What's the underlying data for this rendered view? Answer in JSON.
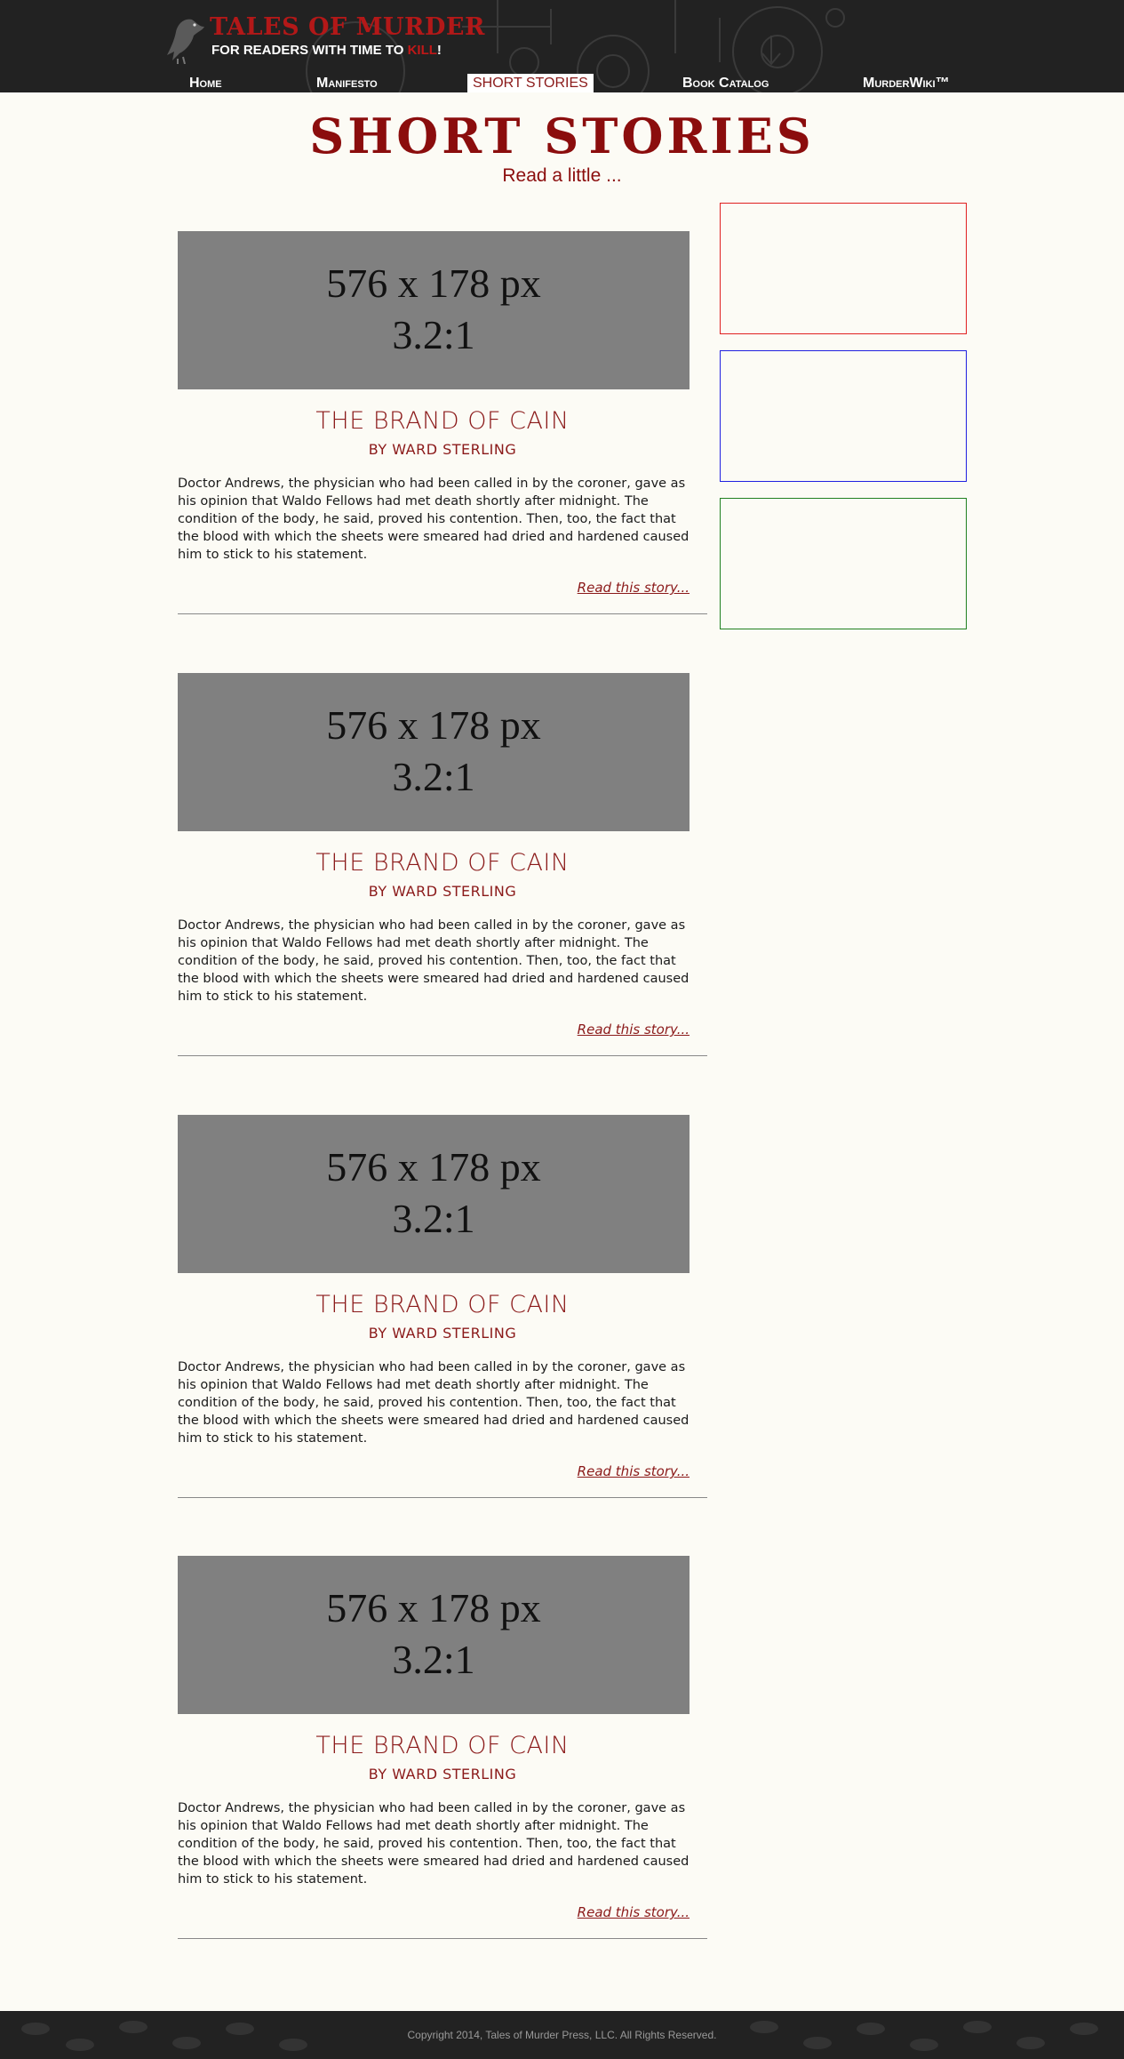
{
  "header": {
    "logo_title": "TALES OF MURDER",
    "tagline_before": "FOR READERS WITH TIME TO ",
    "tagline_red": "KILL",
    "tagline_after": "!"
  },
  "nav": {
    "items": [
      {
        "label": "Home"
      },
      {
        "label": "Manifesto"
      },
      {
        "label": "SHORT STORIES"
      },
      {
        "label": "Book Catalog"
      },
      {
        "label": "MurderWiki™"
      }
    ]
  },
  "page": {
    "title": "SHORT STORIES",
    "subtitle": "Read a little ..."
  },
  "stories": [
    {
      "image_line1": "576 x 178 px",
      "image_line2": "3.2:1",
      "title": "THE BRAND OF CAIN",
      "author": "BY WARD STERLING",
      "excerpt": "Doctor Andrews, the physician who had been called in by the coroner, gave as his opinion that Waldo Fellows had met death shortly after midnight. The condition of the body, he said, proved his contention. Then, too, the fact that the blood with which the sheets were smeared had dried and hardened caused him to stick to his statement.",
      "more": "Read this story..."
    },
    {
      "image_line1": "576 x 178 px",
      "image_line2": "3.2:1",
      "title": "THE BRAND OF CAIN",
      "author": "BY WARD STERLING",
      "excerpt": "Doctor Andrews, the physician who had been called in by the coroner, gave as his opinion that Waldo Fellows had met death shortly after midnight. The condition of the body, he said, proved his contention. Then, too, the fact that the blood with which the sheets were smeared had dried and hardened caused him to stick to his statement.",
      "more": "Read this story..."
    },
    {
      "image_line1": "576 x 178 px",
      "image_line2": "3.2:1",
      "title": "THE BRAND OF CAIN",
      "author": "BY WARD STERLING",
      "excerpt": "Doctor Andrews, the physician who had been called in by the coroner, gave as his opinion that Waldo Fellows had met death shortly after midnight. The condition of the body, he said, proved his contention. Then, too, the fact that the blood with which the sheets were smeared had dried and hardened caused him to stick to his statement.",
      "more": "Read this story..."
    },
    {
      "image_line1": "576 x 178 px",
      "image_line2": "3.2:1",
      "title": "THE BRAND OF CAIN",
      "author": "BY WARD STERLING",
      "excerpt": "Doctor Andrews, the physician who had been called in by the coroner, gave as his opinion that Waldo Fellows had met death shortly after midnight. The condition of the body, he said, proved his contention. Then, too, the fact that the blood with which the sheets were smeared had dried and hardened caused him to stick to his statement.",
      "more": "Read this story..."
    }
  ],
  "sidebar": {
    "ads": [
      {
        "border_color": "#e02020"
      },
      {
        "border_color": "#2020e0"
      },
      {
        "border_color": "#208020"
      }
    ]
  },
  "footer": {
    "copyright": "Copyright 2014, Tales of Murder Press, LLC. All Rights Reserved."
  },
  "colors": {
    "brand_red": "#8b0d0d",
    "header_bg": "#222222",
    "page_bg": "#fcfbf5",
    "placeholder_gray": "#808080"
  }
}
